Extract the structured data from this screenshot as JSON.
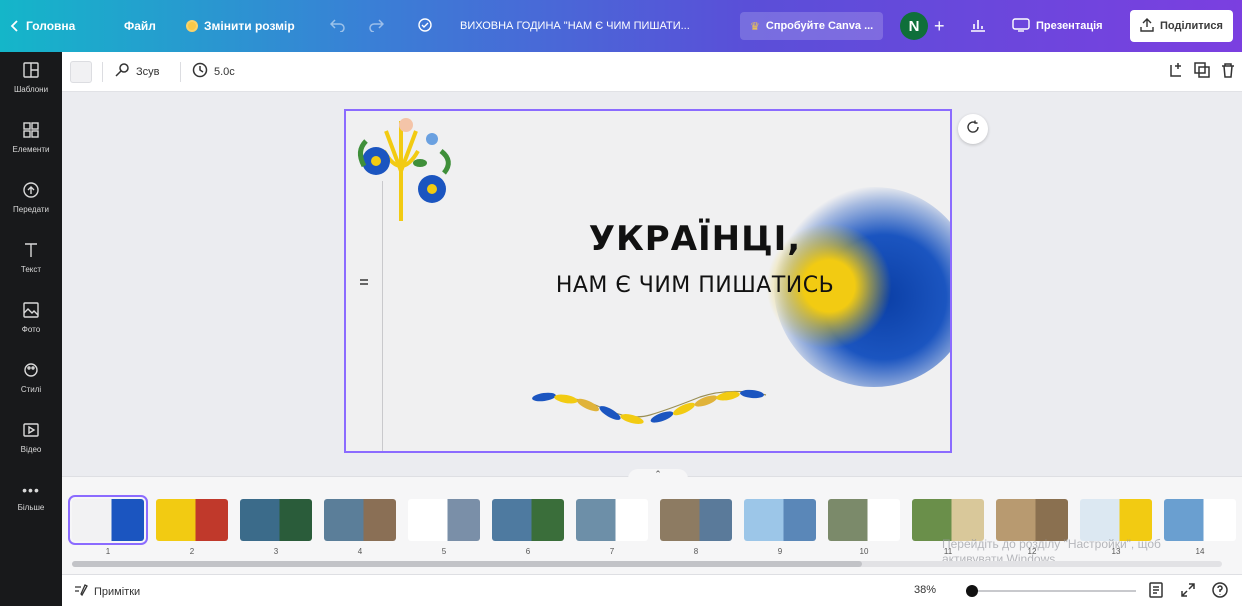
{
  "topbar": {
    "home_label": "Головна",
    "file_label": "Файл",
    "resize_label": "Змінити розмір",
    "doc_title": "ВИХОВНА ГОДИНА \"НАМ Є ЧИМ ПИШАТИ...",
    "try_canva_label": "Спробуйте Canva ...",
    "avatar_initial": "N",
    "present_label": "Презентація",
    "share_label": "Поділитися"
  },
  "sidebar": {
    "items": [
      {
        "label": "Шаблони",
        "icon": "templates-icon"
      },
      {
        "label": "Елементи",
        "icon": "elements-icon"
      },
      {
        "label": "Передати",
        "icon": "upload-icon"
      },
      {
        "label": "Текст",
        "icon": "text-icon"
      },
      {
        "label": "Фото",
        "icon": "photo-icon"
      },
      {
        "label": "Стилі",
        "icon": "styles-icon"
      },
      {
        "label": "Відео",
        "icon": "video-icon"
      },
      {
        "label": "Більше",
        "icon": "more-icon"
      }
    ]
  },
  "toolbar": {
    "animate_label": "Зсув",
    "duration_label": "5.0с"
  },
  "slide": {
    "title": "УКРАЇНЦІ,",
    "subtitle": "НАМ Є ЧИМ ПИШАТИСЬ",
    "colors": {
      "blue": "#0b3fa6",
      "yellow": "#f2cb12",
      "border": "#8b6bff"
    }
  },
  "thumbnails": [
    "1",
    "2",
    "3",
    "4",
    "5",
    "6",
    "7",
    "8",
    "9",
    "10",
    "11",
    "12",
    "13",
    "14"
  ],
  "watermark": {
    "line1": "Перейдіть до розділу \"Настройки\", щоб",
    "line2": "активувати Windows."
  },
  "bottombar": {
    "notes_label": "Примітки",
    "zoom_label": "38%"
  }
}
